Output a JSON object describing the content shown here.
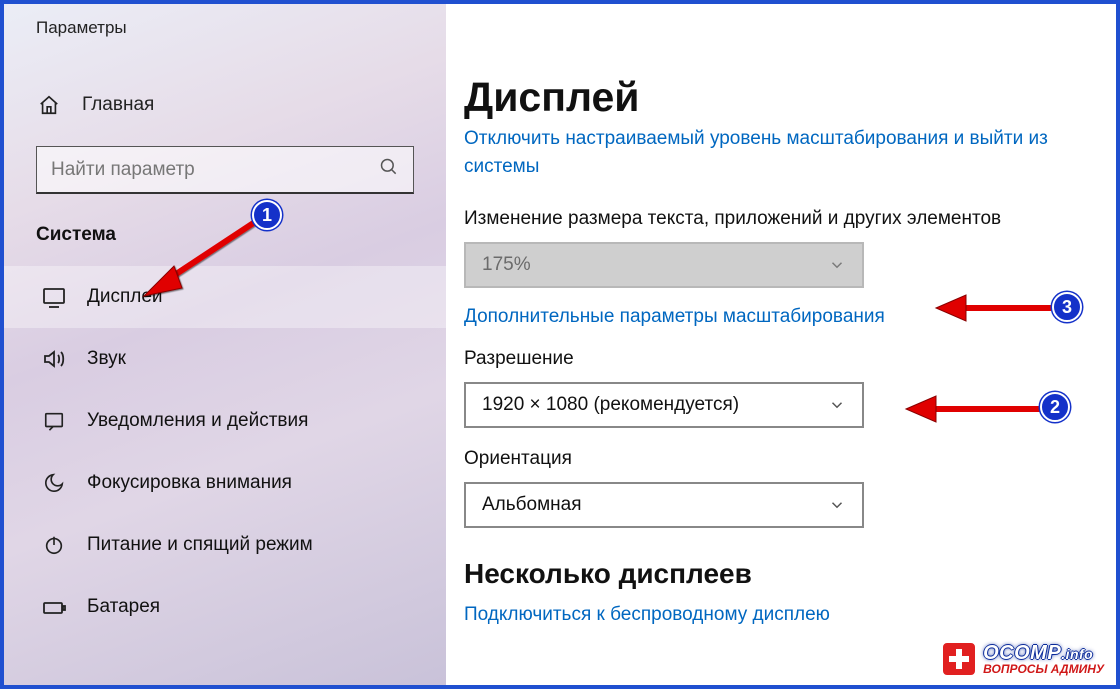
{
  "window": {
    "title": "Параметры"
  },
  "sidebar": {
    "home_label": "Главная",
    "search_placeholder": "Найти параметр",
    "section_label": "Система",
    "items": [
      {
        "label": "Дисплей",
        "icon": "display-icon",
        "active": true
      },
      {
        "label": "Звук",
        "icon": "sound-icon",
        "active": false
      },
      {
        "label": "Уведомления и действия",
        "icon": "notifications-icon",
        "active": false
      },
      {
        "label": "Фокусировка внимания",
        "icon": "moon-icon",
        "active": false
      },
      {
        "label": "Питание и спящий режим",
        "icon": "power-icon",
        "active": false
      },
      {
        "label": "Батарея",
        "icon": "battery-icon",
        "active": false
      }
    ]
  },
  "page": {
    "heading": "Дисплей",
    "signout_link": "Отключить настраиваемый уровень масштабирования и выйти из системы",
    "scale_label": "Изменение размера текста, приложений и других элементов",
    "scale_value": "175%",
    "adv_scaling_link": "Дополнительные параметры масштабирования",
    "resolution_label": "Разрешение",
    "resolution_value": "1920 × 1080 (рекомендуется)",
    "orientation_label": "Ориентация",
    "orientation_value": "Альбомная",
    "multi_heading": "Несколько дисплеев",
    "wireless_link": "Подключиться к беспроводному дисплею"
  },
  "annotations": {
    "badge1": "1",
    "badge2": "2",
    "badge3": "3"
  },
  "watermark": {
    "brand": "OCOMP",
    "tld": ".info",
    "tag": "ВОПРОСЫ АДМИНУ"
  }
}
